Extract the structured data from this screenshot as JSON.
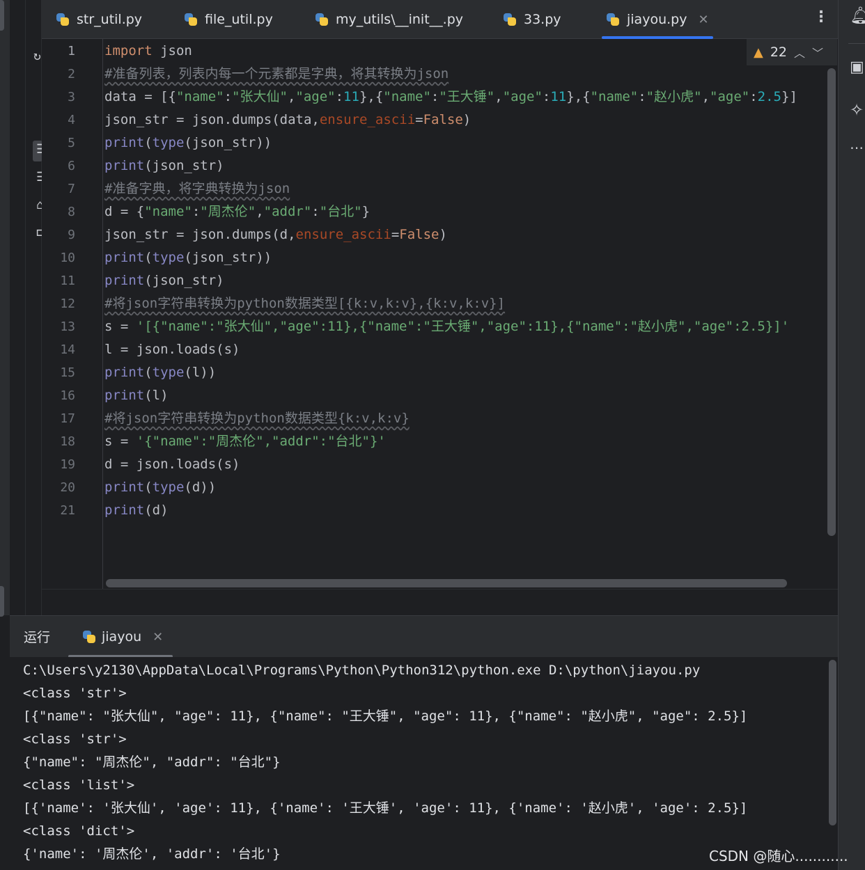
{
  "tabs": [
    {
      "label": "str_util.py",
      "active": false
    },
    {
      "label": "file_util.py",
      "active": false
    },
    {
      "label": "my_utils\\__init__.py",
      "active": false
    },
    {
      "label": "33.py",
      "active": false
    },
    {
      "label": "jiayou.py",
      "active": true
    }
  ],
  "editor": {
    "warning_count": "22",
    "line_numbers": [
      "1",
      "2",
      "3",
      "4",
      "5",
      "6",
      "7",
      "8",
      "9",
      "10",
      "11",
      "12",
      "13",
      "14",
      "15",
      "16",
      "17",
      "18",
      "19",
      "20",
      "21"
    ],
    "lines": [
      [
        {
          "t": "kw",
          "v": "import"
        },
        {
          "t": "",
          "v": " json"
        }
      ],
      [
        {
          "t": "cm",
          "v": "#准备列表，列表内每一个元素都是字典，将其转换为json"
        }
      ],
      [
        {
          "t": "",
          "v": "data = [{"
        },
        {
          "t": "str",
          "v": "\"name\""
        },
        {
          "t": "",
          "v": ":"
        },
        {
          "t": "str",
          "v": "\"张大仙\""
        },
        {
          "t": "",
          "v": ","
        },
        {
          "t": "str",
          "v": "\"age\""
        },
        {
          "t": "",
          "v": ":"
        },
        {
          "t": "num",
          "v": "11"
        },
        {
          "t": "",
          "v": "},{"
        },
        {
          "t": "str",
          "v": "\"name\""
        },
        {
          "t": "",
          "v": ":"
        },
        {
          "t": "str",
          "v": "\"王大锤\""
        },
        {
          "t": "",
          "v": ","
        },
        {
          "t": "str",
          "v": "\"age\""
        },
        {
          "t": "",
          "v": ":"
        },
        {
          "t": "num",
          "v": "11"
        },
        {
          "t": "",
          "v": "},{"
        },
        {
          "t": "str",
          "v": "\"name\""
        },
        {
          "t": "",
          "v": ":"
        },
        {
          "t": "str",
          "v": "\"赵小虎\""
        },
        {
          "t": "",
          "v": ","
        },
        {
          "t": "str",
          "v": "\"age\""
        },
        {
          "t": "",
          "v": ":"
        },
        {
          "t": "num",
          "v": "2.5"
        },
        {
          "t": "",
          "v": "}]"
        }
      ],
      [
        {
          "t": "",
          "v": "json_str = json.dumps(data,"
        },
        {
          "t": "par",
          "v": "ensure_ascii"
        },
        {
          "t": "",
          "v": "="
        },
        {
          "t": "kw",
          "v": "False"
        },
        {
          "t": "",
          "v": ")"
        }
      ],
      [
        {
          "t": "bi",
          "v": "print"
        },
        {
          "t": "",
          "v": "("
        },
        {
          "t": "bi",
          "v": "type"
        },
        {
          "t": "",
          "v": "(json_str))"
        }
      ],
      [
        {
          "t": "bi",
          "v": "print"
        },
        {
          "t": "",
          "v": "(json_str)"
        }
      ],
      [
        {
          "t": "cm",
          "v": "#准备字典，将字典转换为json"
        }
      ],
      [
        {
          "t": "",
          "v": "d = {"
        },
        {
          "t": "str",
          "v": "\"name\""
        },
        {
          "t": "",
          "v": ":"
        },
        {
          "t": "str",
          "v": "\"周杰伦\""
        },
        {
          "t": "",
          "v": ","
        },
        {
          "t": "str",
          "v": "\"addr\""
        },
        {
          "t": "",
          "v": ":"
        },
        {
          "t": "str",
          "v": "\"台北\""
        },
        {
          "t": "",
          "v": "}"
        }
      ],
      [
        {
          "t": "",
          "v": "json_str = json.dumps(d,"
        },
        {
          "t": "par",
          "v": "ensure_ascii"
        },
        {
          "t": "",
          "v": "="
        },
        {
          "t": "kw",
          "v": "False"
        },
        {
          "t": "",
          "v": ")"
        }
      ],
      [
        {
          "t": "bi",
          "v": "print"
        },
        {
          "t": "",
          "v": "("
        },
        {
          "t": "bi",
          "v": "type"
        },
        {
          "t": "",
          "v": "(json_str))"
        }
      ],
      [
        {
          "t": "bi",
          "v": "print"
        },
        {
          "t": "",
          "v": "(json_str)"
        }
      ],
      [
        {
          "t": "cm",
          "v": "#将json字符串转换为python数据类型[{k:v,k:v},{k:v,k:v}]"
        }
      ],
      [
        {
          "t": "",
          "v": "s = "
        },
        {
          "t": "str",
          "v": "'[{\"name\":\"张大仙\",\"age\":11},{\"name\":\"王大锤\",\"age\":11},{\"name\":\"赵小虎\",\"age\":2.5}]'"
        }
      ],
      [
        {
          "t": "",
          "v": "l = json.loads(s)"
        }
      ],
      [
        {
          "t": "bi",
          "v": "print"
        },
        {
          "t": "",
          "v": "("
        },
        {
          "t": "bi",
          "v": "type"
        },
        {
          "t": "",
          "v": "(l))"
        }
      ],
      [
        {
          "t": "bi",
          "v": "print"
        },
        {
          "t": "",
          "v": "(l)"
        }
      ],
      [
        {
          "t": "cm",
          "v": "#将json字符串转换为python数据类型{k:v,k:v}"
        }
      ],
      [
        {
          "t": "",
          "v": "s = "
        },
        {
          "t": "str",
          "v": "'{\"name\":\"周杰伦\",\"addr\":\"台北\"}'"
        }
      ],
      [
        {
          "t": "",
          "v": "d = json.loads(s)"
        }
      ],
      [
        {
          "t": "bi",
          "v": "print"
        },
        {
          "t": "",
          "v": "("
        },
        {
          "t": "bi",
          "v": "type"
        },
        {
          "t": "",
          "v": "(d))"
        }
      ],
      [
        {
          "t": "bi",
          "v": "print"
        },
        {
          "t": "",
          "v": "(d)"
        }
      ]
    ]
  },
  "run_panel": {
    "title": "运行",
    "tab_label": "jiayou",
    "output": [
      "C:\\Users\\y2130\\AppData\\Local\\Programs\\Python\\Python312\\python.exe D:\\python\\jiayou.py",
      "<class 'str'>",
      "[{\"name\": \"张大仙\", \"age\": 11}, {\"name\": \"王大锤\", \"age\": 11}, {\"name\": \"赵小虎\", \"age\": 2.5}]",
      "<class 'str'>",
      "{\"name\": \"周杰伦\", \"addr\": \"台北\"}",
      "<class 'list'>",
      "[{'name': '张大仙', 'age': 11}, {'name': '王大锤', 'age': 11}, {'name': '赵小虎', 'age': 2.5}]",
      "<class 'dict'>",
      "{'name': '周杰伦', 'addr': '台北'}"
    ]
  },
  "watermark": "CSDN @随心............",
  "icons": {
    "tab_file": "python-file-icon",
    "warning": "warning-triangle-icon",
    "notifications": "bell-icon",
    "ai_assistant": "sparkle-icon"
  }
}
